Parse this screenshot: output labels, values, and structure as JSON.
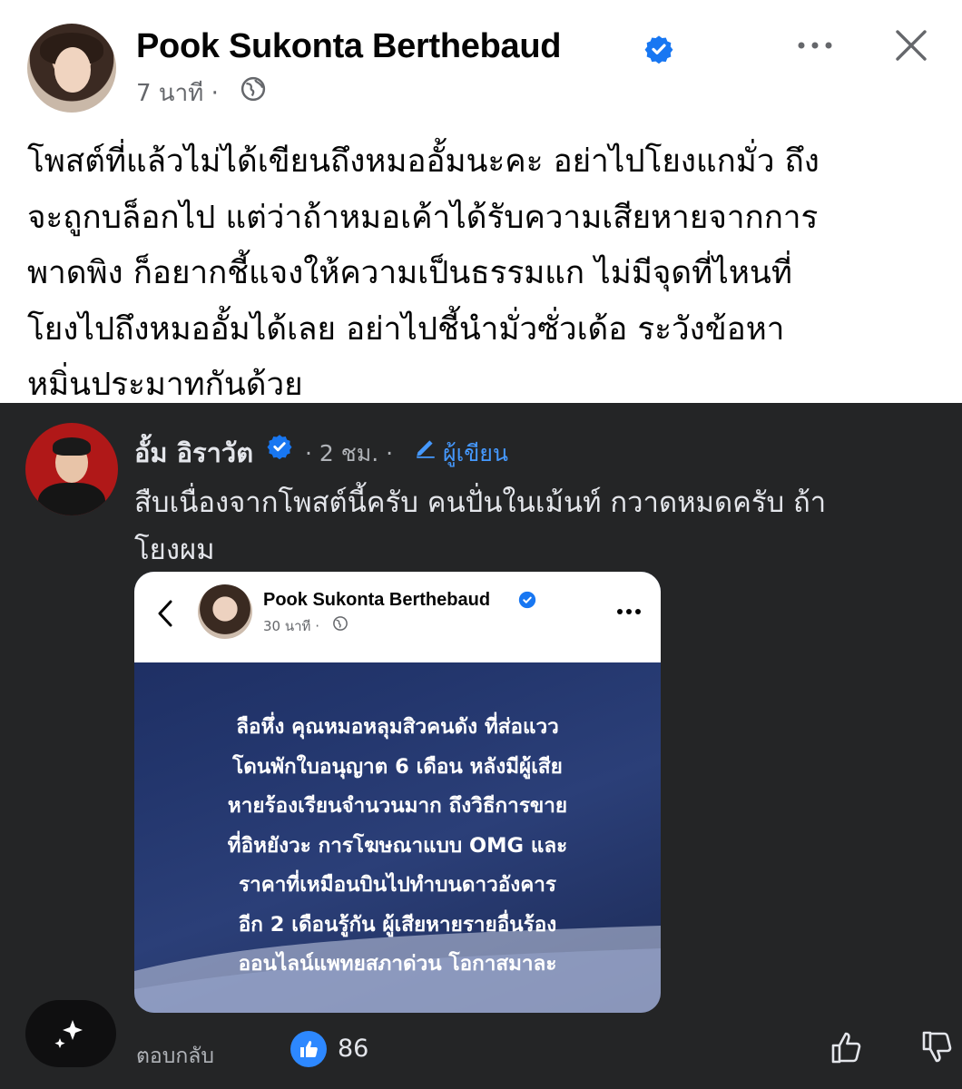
{
  "post": {
    "author": "Pook Sukonta Berthebaud",
    "time": "7 นาที ·",
    "lines": [
      "โพสต์ที่แล้วไม่ได้เขียนถึงหมออั้มนะคะ อย่าไปโยงแกมั่ว ถึง",
      "จะถูกบล็อกไป แต่ว่าถ้าหมอเค้าได้รับความเสียหายจากการ",
      "พาดพิง ก็อยากชี้แจงให้ความเป็นธรรมแก ไม่มีจุดที่ไหนที่",
      "โยงไปถึงหมออั้มได้เลย อย่าไปชี้นำมั่วซั่วเด้อ ระวังข้อหา",
      "หมิ่นประมาทกันด้วย"
    ]
  },
  "comment": {
    "author": "อั้ม อิราวัต",
    "meta": "· 2 ชม. ·",
    "author_badge": "ผู้เขียน",
    "lines": [
      "สืบเนื่องจากโพสต์นี้ครับ คนปั่นในเม้นท์ กวาดหมดครับ ถ้า",
      "โยงผม"
    ],
    "reply_label": "ตอบกลับ",
    "like_count": "86"
  },
  "embedded": {
    "author": "Pook Sukonta Berthebaud",
    "time": "30 นาที ·",
    "lines": [
      "ลือหึ่ง คุณหมอหลุมสิวคนดัง ที่ส่อแวว",
      "โดนพักใบอนุญาต 6 เดือน หลังมีผู้เสีย",
      "หายร้องเรียนจำนวนมาก ถึงวิธีการขาย",
      "ที่อิหยังวะ การโฆษณาแบบ OMG และ",
      "ราคาที่เหมือนบินไปทำบนดาวอังคาร",
      "อีก 2 เดือนรู้กัน ผู้เสียหายรายอื่นร้อง",
      "ออนไลน์แพทยสภาด่วน โอกาสมาละ"
    ]
  },
  "colors": {
    "verified": "#1877f2",
    "dark_bg": "#242526",
    "link_blue": "#4599ff",
    "like_blue": "#2d88ff"
  },
  "icons": [
    "verified-badge-icon",
    "globe-icon",
    "more-icon",
    "close-icon",
    "back-chevron-icon",
    "pen-icon",
    "sparkle-icon",
    "like-icon",
    "thumb-up-icon",
    "thumb-down-icon"
  ]
}
